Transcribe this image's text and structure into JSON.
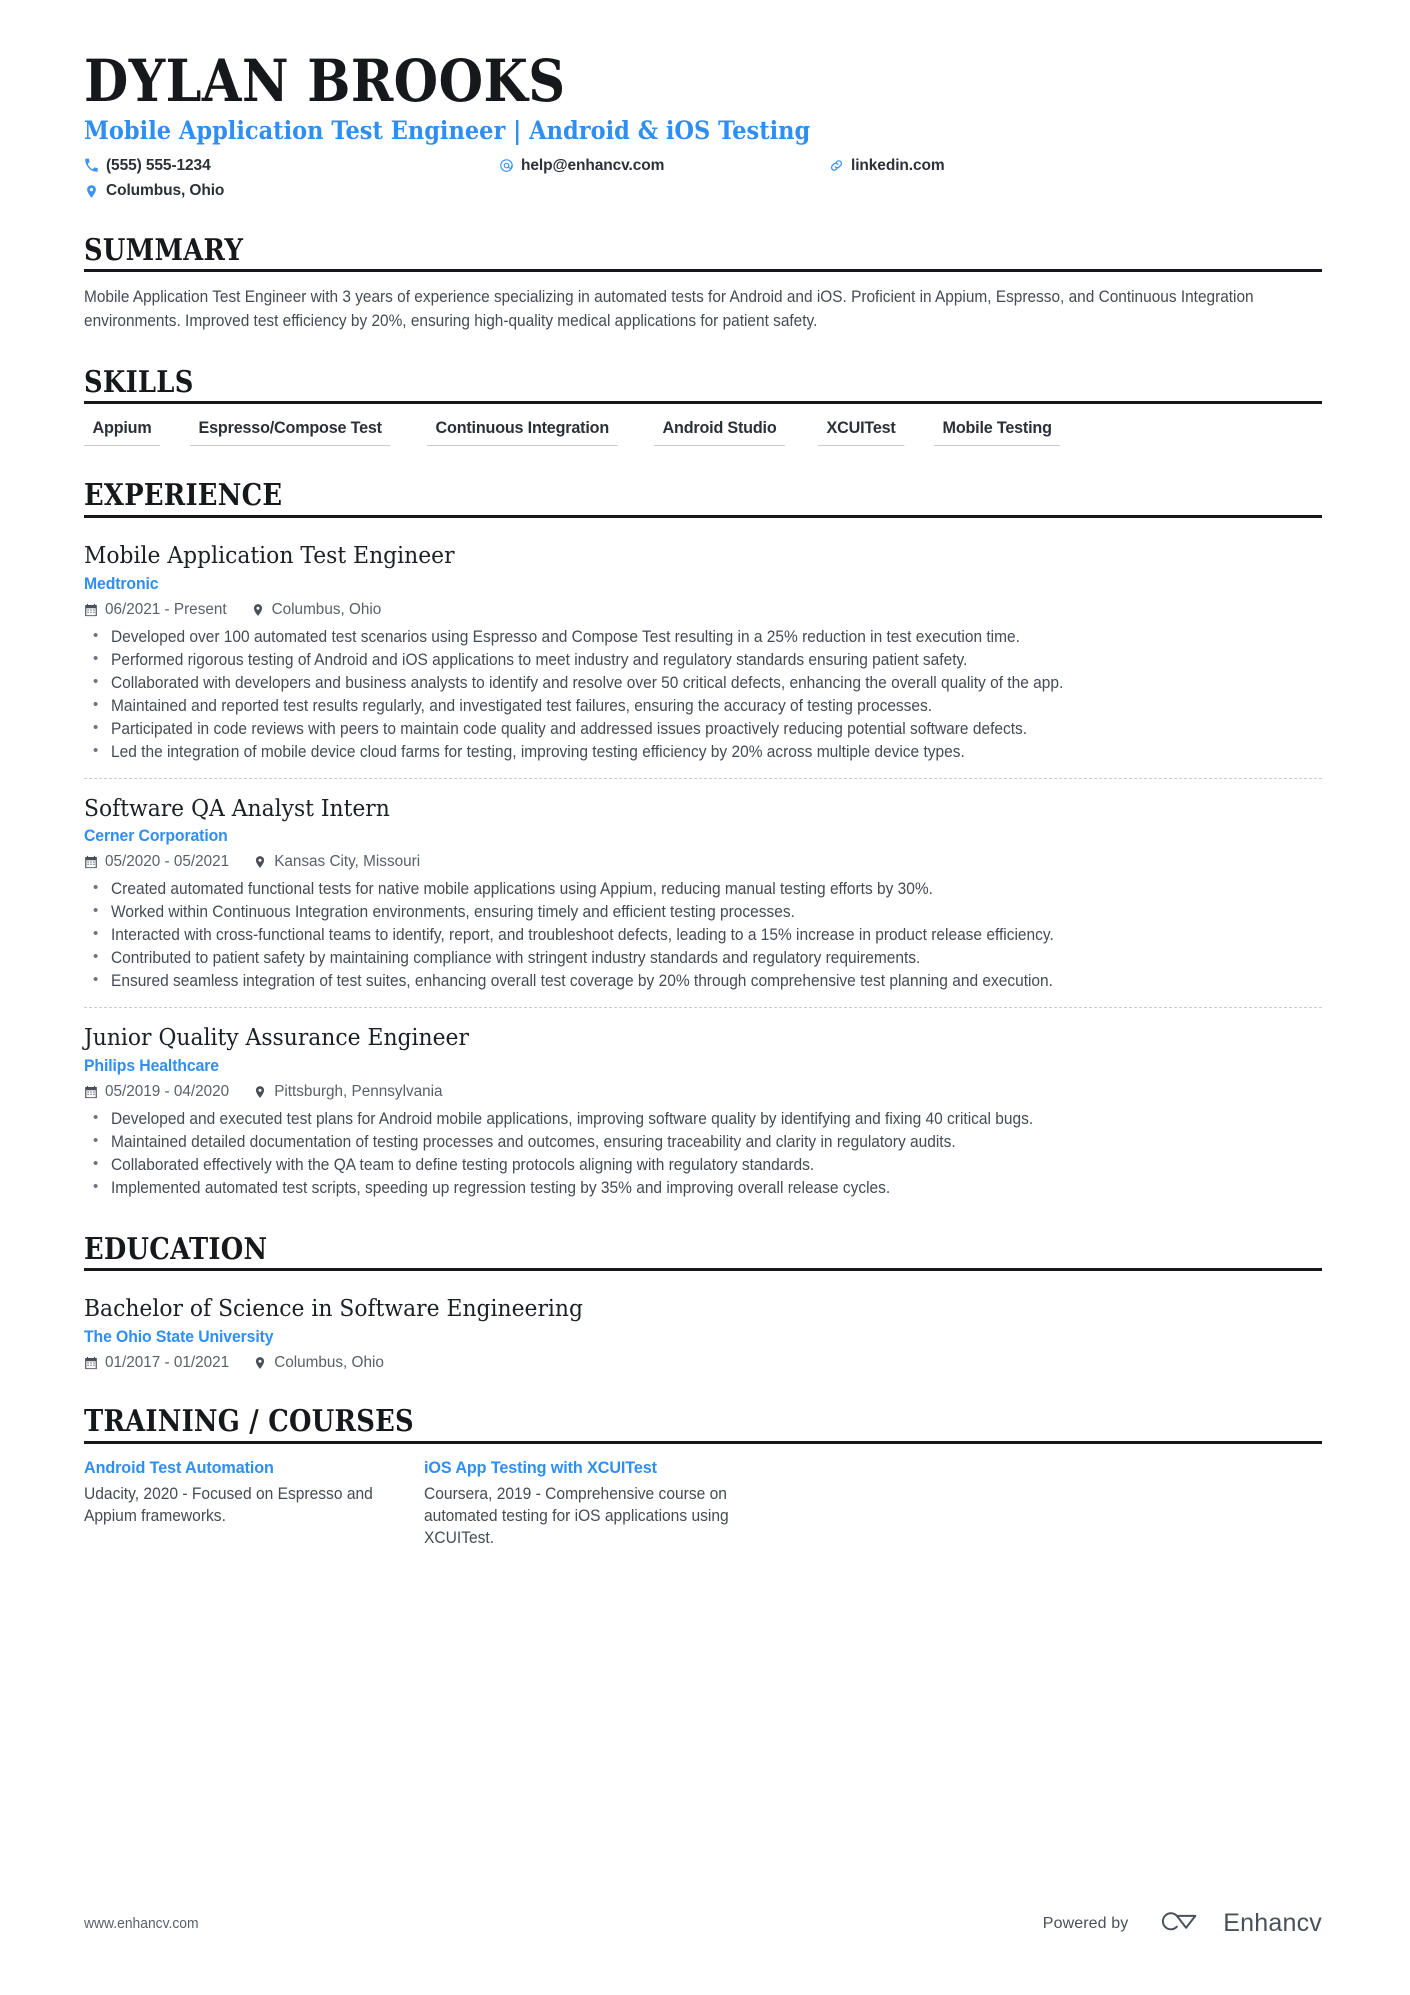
{
  "header": {
    "name": "DYLAN BROOKS",
    "headline": "Mobile Application Test Engineer | Android & iOS Testing",
    "contacts": [
      {
        "icon": "phone-icon",
        "text": "(555) 555-1234"
      },
      {
        "icon": "email-icon",
        "text": "help@enhancv.com"
      },
      {
        "icon": "link-icon",
        "text": "linkedin.com"
      },
      {
        "icon": "location-icon",
        "text": "Columbus, Ohio"
      }
    ]
  },
  "summary": {
    "heading": "SUMMARY",
    "text": "Mobile Application Test Engineer with 3 years of experience specializing in automated tests for Android and iOS. Proficient in Appium, Espresso, and Continuous Integration environments. Improved test efficiency by 20%, ensuring high-quality medical applications for patient safety."
  },
  "skills": {
    "heading": "SKILLS",
    "items": [
      "Appium",
      "Espresso/Compose Test",
      "Continuous Integration",
      "Android Studio",
      "XCUITest",
      "Mobile Testing"
    ]
  },
  "experience": {
    "heading": "EXPERIENCE",
    "entries": [
      {
        "title": "Mobile Application Test Engineer",
        "organization": "Medtronic",
        "dates": "06/2021 - Present",
        "location": "Columbus, Ohio",
        "bullets": [
          "Developed over 100 automated test scenarios using Espresso and Compose Test resulting in a 25% reduction in test execution time.",
          "Performed rigorous testing of Android and iOS applications to meet industry and regulatory standards ensuring patient safety.",
          "Collaborated with developers and business analysts to identify and resolve over 50 critical defects, enhancing the overall quality of the app.",
          "Maintained and reported test results regularly, and investigated test failures, ensuring the accuracy of testing processes.",
          "Participated in code reviews with peers to maintain code quality and addressed issues proactively reducing potential software defects.",
          "Led the integration of mobile device cloud farms for testing, improving testing efficiency by 20% across multiple device types."
        ]
      },
      {
        "title": "Software QA Analyst Intern",
        "organization": "Cerner Corporation",
        "dates": "05/2020 - 05/2021",
        "location": "Kansas City, Missouri",
        "bullets": [
          "Created automated functional tests for native mobile applications using Appium, reducing manual testing efforts by 30%.",
          "Worked within Continuous Integration environments, ensuring timely and efficient testing processes.",
          "Interacted with cross-functional teams to identify, report, and troubleshoot defects, leading to a 15% increase in product release efficiency.",
          "Contributed to patient safety by maintaining compliance with stringent industry standards and regulatory requirements.",
          "Ensured seamless integration of test suites, enhancing overall test coverage by 20% through comprehensive test planning and execution."
        ]
      },
      {
        "title": "Junior Quality Assurance Engineer",
        "organization": "Philips Healthcare",
        "dates": "05/2019 - 04/2020",
        "location": "Pittsburgh, Pennsylvania",
        "bullets": [
          "Developed and executed test plans for Android mobile applications, improving software quality by identifying and fixing 40 critical bugs.",
          "Maintained detailed documentation of testing processes and outcomes, ensuring traceability and clarity in regulatory audits.",
          "Collaborated effectively with the QA team to define testing protocols aligning with regulatory standards.",
          "Implemented automated test scripts, speeding up regression testing by 35% and improving overall release cycles."
        ]
      }
    ]
  },
  "education": {
    "heading": "EDUCATION",
    "entries": [
      {
        "title": "Bachelor of Science in Software Engineering",
        "organization": "The Ohio State University",
        "dates": "01/2017 - 01/2021",
        "location": "Columbus, Ohio"
      }
    ]
  },
  "training": {
    "heading": "TRAINING / COURSES",
    "items": [
      {
        "title": "Android Test Automation",
        "description": "Udacity, 2020 - Focused on Espresso and Appium frameworks."
      },
      {
        "title": "iOS App Testing with XCUITest",
        "description": "Coursera, 2019 - Comprehensive course on automated testing for iOS applications using XCUITest."
      }
    ]
  },
  "footer": {
    "url": "www.enhancv.com",
    "powered_by": "Powered by",
    "brand": "Enhancv"
  },
  "colors": {
    "accent": "#2f8ef2",
    "icon_accent": "#3b93f5",
    "heading": "#16181c",
    "body": "#454b54",
    "muted": "#5a6069",
    "rule": "#c9cdd2"
  }
}
